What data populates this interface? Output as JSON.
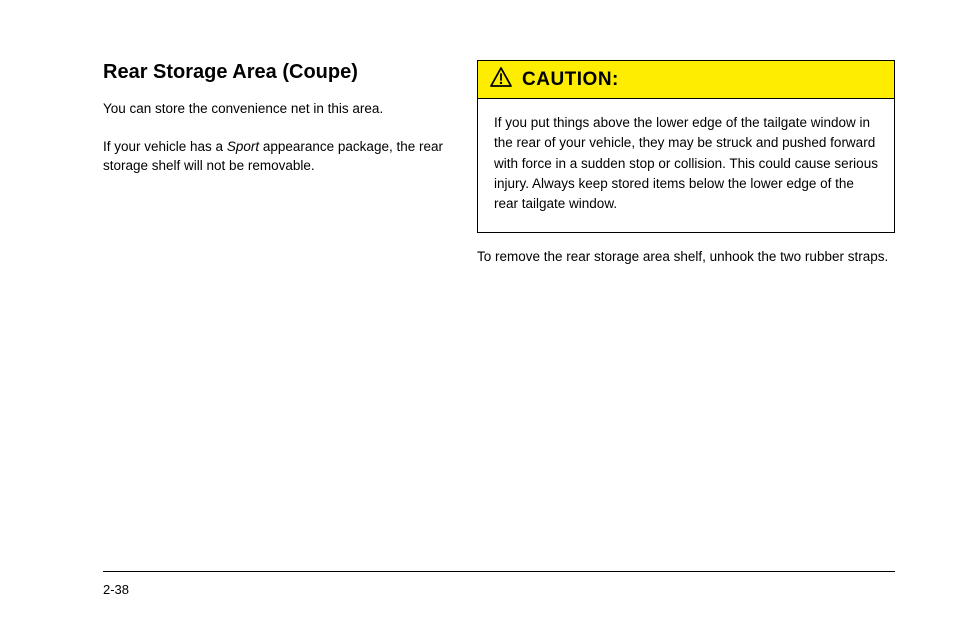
{
  "left": {
    "heading": "Rear Storage Area (Coupe)",
    "p1": "You can store the convenience net in this area.",
    "p2_a": "If your vehicle has a ",
    "p2_b_emph": "Sport",
    "p2_c": " appearance package, the rear storage shelf will not be removable."
  },
  "caution": {
    "label": "CAUTION:",
    "body": "If you put things above the lower edge of the tailgate window in the rear of your vehicle, they may be struck and pushed forward with force in a sudden stop or collision. This could cause serious injury. Always keep stored items below the lower edge of the rear tailgate window."
  },
  "right": {
    "p1": "To remove the rear storage area shelf, unhook the two rubber straps."
  },
  "footer": {
    "page_number": "2-38"
  }
}
